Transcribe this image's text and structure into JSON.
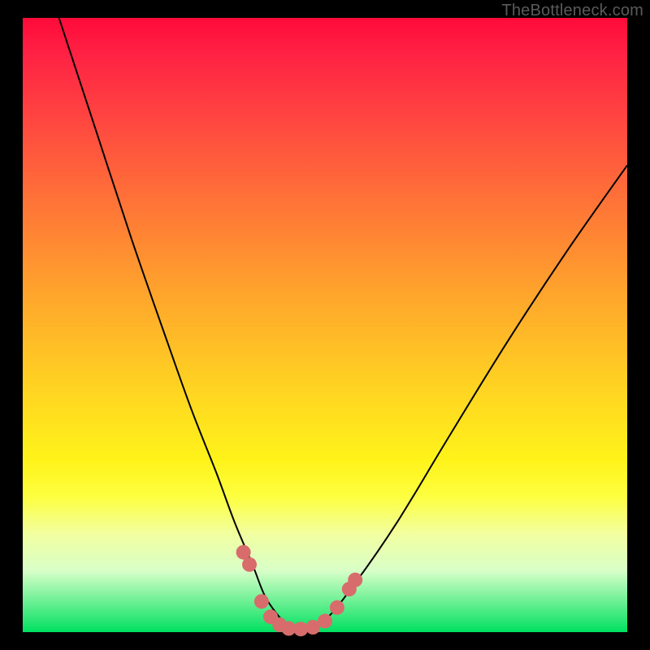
{
  "watermark": "TheBottleneck.com",
  "colors": {
    "background": "#000000",
    "gradient_top": "#ff0a3a",
    "gradient_bottom": "#00e060",
    "curve": "#000000",
    "marker": "#d86b6b"
  },
  "chart_data": {
    "type": "line",
    "title": "",
    "xlabel": "",
    "ylabel": "",
    "xlim": [
      0,
      100
    ],
    "ylim": [
      0,
      100
    ],
    "grid": false,
    "note": "Axes unlabeled in image; x/y expressed as 0–100 percent of plot area. y=100 is top, y=0 is bottom.",
    "series": [
      {
        "name": "bottleneck-curve",
        "x": [
          6,
          12,
          18,
          24,
          28,
          32,
          35,
          38,
          40,
          42,
          44,
          46,
          50,
          55,
          62,
          70,
          80,
          90,
          100
        ],
        "y": [
          100,
          82,
          64,
          47,
          36,
          26,
          18,
          11,
          6,
          3,
          1,
          0.5,
          2,
          8,
          18,
          31,
          47,
          62,
          76
        ]
      }
    ],
    "markers": [
      {
        "x": 36.5,
        "y": 13
      },
      {
        "x": 37.5,
        "y": 11
      },
      {
        "x": 39.5,
        "y": 5
      },
      {
        "x": 41.0,
        "y": 2.5
      },
      {
        "x": 42.5,
        "y": 1.2
      },
      {
        "x": 44.0,
        "y": 0.6
      },
      {
        "x": 46.0,
        "y": 0.5
      },
      {
        "x": 48.0,
        "y": 0.8
      },
      {
        "x": 50.0,
        "y": 1.8
      },
      {
        "x": 52.0,
        "y": 4
      },
      {
        "x": 54.0,
        "y": 7
      },
      {
        "x": 55.0,
        "y": 8.5
      }
    ]
  }
}
